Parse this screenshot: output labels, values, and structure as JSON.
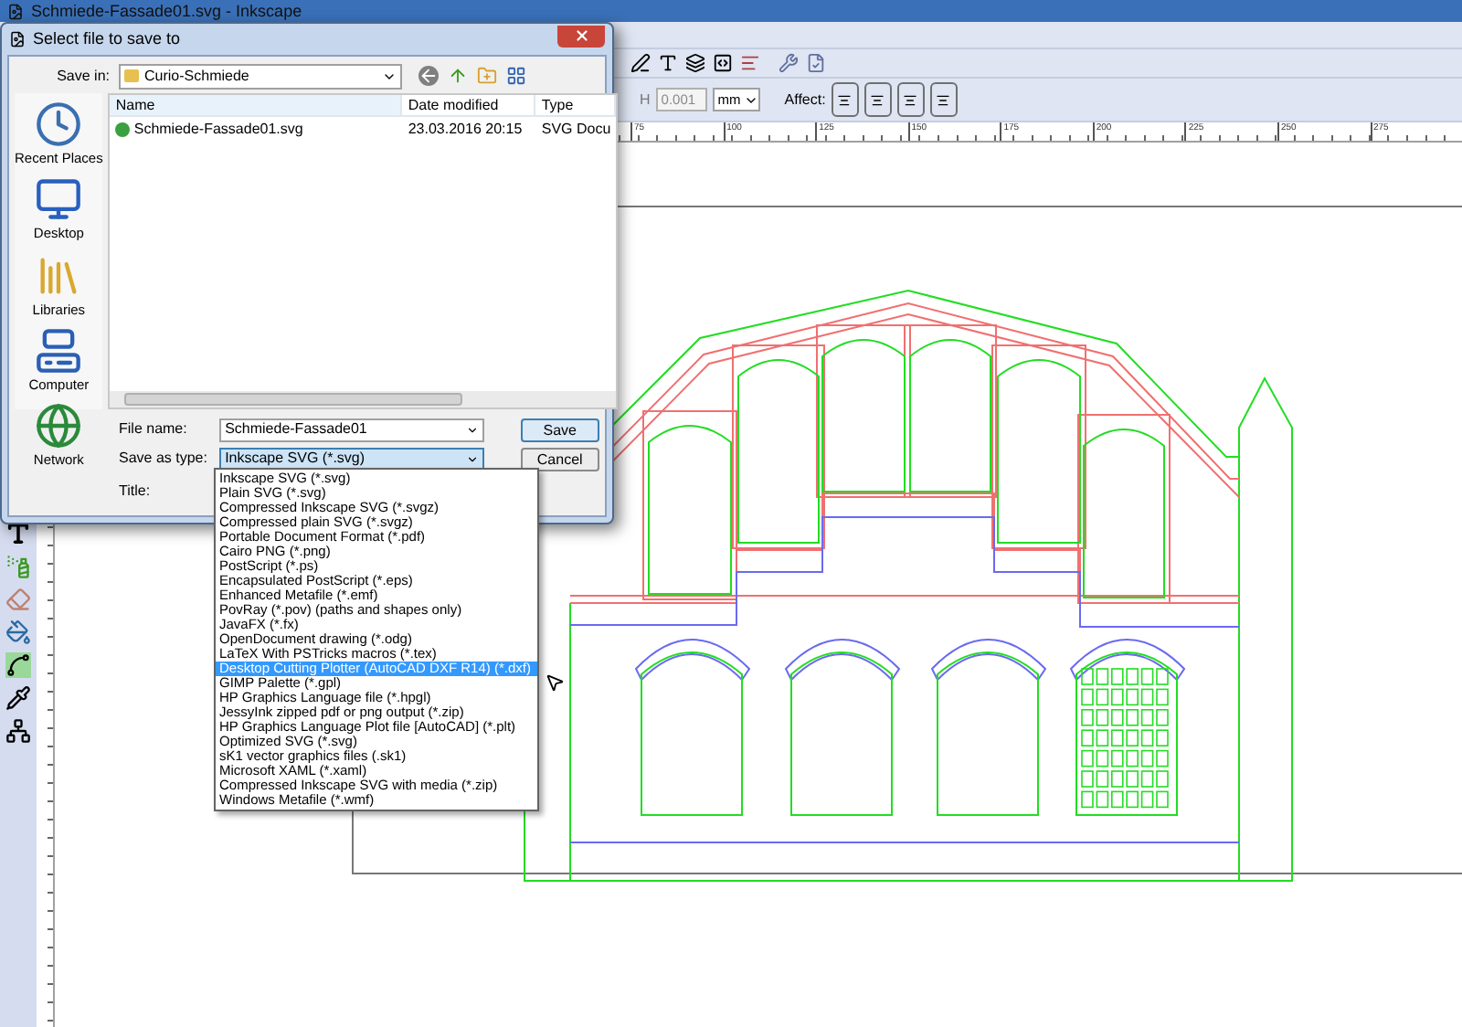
{
  "app_window": {
    "title": "Schmiede-Fassade01.svg - Inkscape"
  },
  "tool_controls": {
    "h_label": "H",
    "h_value": "0.001",
    "unit": "mm",
    "affect_label": "Affect:"
  },
  "ruler_labels": [
    "75",
    "100",
    "125",
    "150",
    "175",
    "200",
    "225",
    "250",
    "275"
  ],
  "dialog": {
    "title": "Select file to save to",
    "save_in_label": "Save in:",
    "save_in_value": "Curio-Schmiede",
    "places": [
      {
        "label": "Recent Places",
        "kind": "recent"
      },
      {
        "label": "Desktop",
        "kind": "desktop"
      },
      {
        "label": "Libraries",
        "kind": "libraries"
      },
      {
        "label": "Computer",
        "kind": "computer"
      },
      {
        "label": "Network",
        "kind": "network"
      }
    ],
    "columns": [
      "Name",
      "Date modified",
      "Type"
    ],
    "files": [
      {
        "name": "Schmiede-Fassade01.svg",
        "date": "23.03.2016 20:15",
        "type": "SVG Docu"
      }
    ],
    "file_name_label": "File name:",
    "file_name_value": "Schmiede-Fassade01",
    "save_as_type_label": "Save as type:",
    "save_as_type_value": "Inkscape SVG (*.svg)",
    "title_label": "Title:",
    "buttons": [
      "Save",
      "Cancel"
    ]
  },
  "file_type_options": [
    {
      "label": "Inkscape SVG (*.svg)",
      "selected": false
    },
    {
      "label": "Plain SVG (*.svg)",
      "selected": false
    },
    {
      "label": "Compressed Inkscape SVG (*.svgz)",
      "selected": false
    },
    {
      "label": "Compressed plain SVG (*.svgz)",
      "selected": false
    },
    {
      "label": "Portable Document Format (*.pdf)",
      "selected": false
    },
    {
      "label": "Cairo PNG (*.png)",
      "selected": false
    },
    {
      "label": "PostScript (*.ps)",
      "selected": false
    },
    {
      "label": "Encapsulated PostScript (*.eps)",
      "selected": false
    },
    {
      "label": "Enhanced Metafile (*.emf)",
      "selected": false
    },
    {
      "label": "PovRay (*.pov) (paths and shapes only)",
      "selected": false
    },
    {
      "label": "JavaFX (*.fx)",
      "selected": false
    },
    {
      "label": "OpenDocument drawing (*.odg)",
      "selected": false
    },
    {
      "label": "LaTeX With PSTricks macros (*.tex)",
      "selected": false
    },
    {
      "label": "Desktop Cutting Plotter (AutoCAD DXF R14) (*.dxf)",
      "selected": true
    },
    {
      "label": "GIMP Palette (*.gpl)",
      "selected": false
    },
    {
      "label": "HP Graphics Language file (*.hpgl)",
      "selected": false
    },
    {
      "label": "JessyInk zipped pdf or png output (*.zip)",
      "selected": false
    },
    {
      "label": "HP Graphics Language Plot file [AutoCAD] (*.plt)",
      "selected": false
    },
    {
      "label": "Optimized SVG (*.svg)",
      "selected": false
    },
    {
      "label": "sK1 vector graphics files (.sk1)",
      "selected": false
    },
    {
      "label": "Microsoft XAML (*.xaml)",
      "selected": false
    },
    {
      "label": "Compressed Inkscape SVG with media (*.zip)",
      "selected": false
    },
    {
      "label": "Windows Metafile (*.wmf)",
      "selected": false
    }
  ]
}
